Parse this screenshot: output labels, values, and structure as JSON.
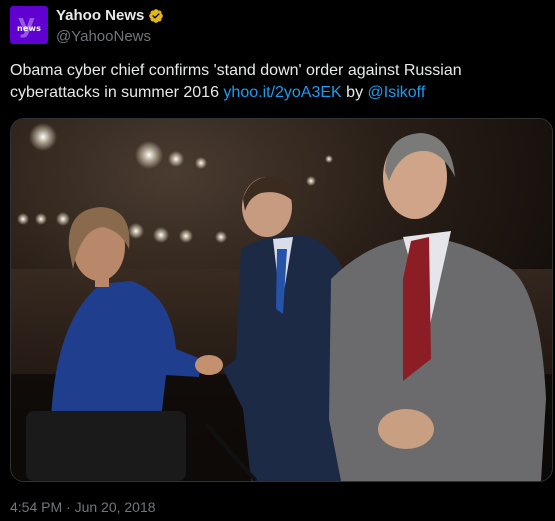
{
  "author": {
    "display_name": "Yahoo News",
    "handle": "@YahooNews",
    "avatar_text": "news",
    "brand_color": "#6001d2",
    "verified_badge_color": "#e2b719"
  },
  "tweet": {
    "text_main": "Obama cyber chief confirms 'stand down' order against Russian cyberattacks in summer 2016 ",
    "link": "yhoo.it/2yoA3EK",
    "by_text": " by ",
    "mention": "@Isikoff",
    "timestamp": "4:54 PM · Jun 20, 2018"
  },
  "media": {
    "description_icon": "photo"
  },
  "colors": {
    "background": "#000000",
    "text": "#e7e9ea",
    "muted": "#71767b",
    "link": "#1d9bf0"
  }
}
